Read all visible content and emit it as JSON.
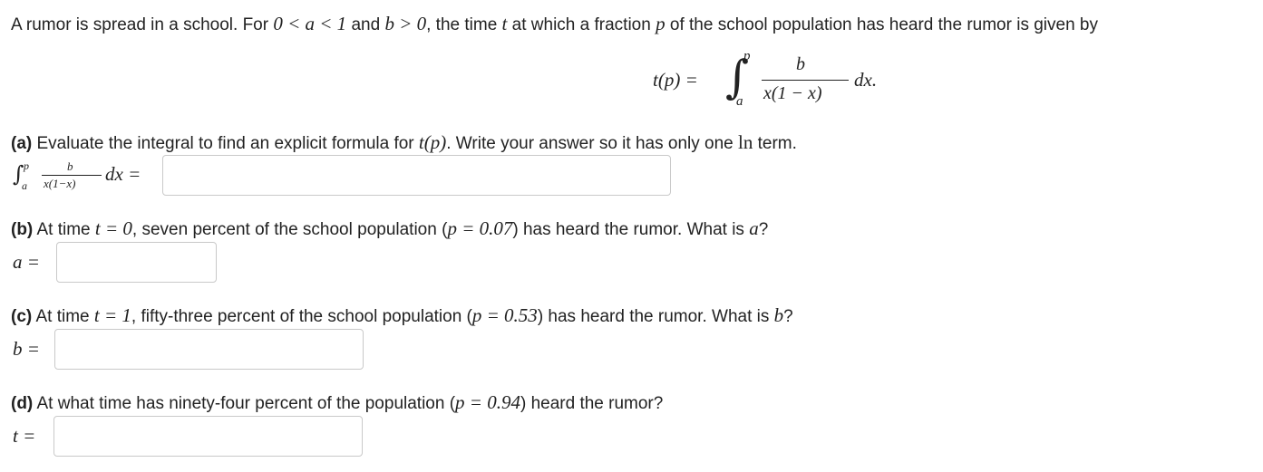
{
  "intro": {
    "text_1": "A rumor is spread in a school. For ",
    "math_1": "0 < a < 1",
    "text_2": " and ",
    "math_2": "b > 0",
    "text_3": ", the time ",
    "math_3": "t",
    "text_4": " at which a fraction ",
    "math_4": "p",
    "text_5": " of the school population has heard the rumor is given by"
  },
  "formula": {
    "lhs": "t(p) =",
    "upper": "p",
    "lower": "a",
    "numerator": "b",
    "denominator": "x(1 − x)",
    "differential": "dx."
  },
  "part_a": {
    "label": "(a)",
    "text_1": " Evaluate the integral to find an explicit formula for ",
    "math_1": "t(p)",
    "text_2": ". Write your answer so it has only one ",
    "math_2": "ln",
    "text_3": " term.",
    "answer_label": {
      "upper": "p",
      "lower": "a",
      "numerator": "b",
      "denominator": "x(1−x)",
      "differential": "dx ="
    },
    "answer_value": ""
  },
  "part_b": {
    "label": "(b)",
    "text_1": " At time ",
    "math_1": "t = 0",
    "text_2": ", seven percent of the school population (",
    "math_2": "p = 0.07",
    "text_3": ") has heard the rumor. What is ",
    "math_3": "a",
    "text_4": "?",
    "answer_label": "a =",
    "answer_value": ""
  },
  "part_c": {
    "label": "(c)",
    "text_1": " At time ",
    "math_1": "t = 1",
    "text_2": ", fifty-three percent of the school population (",
    "math_2": "p = 0.53",
    "text_3": ") has heard the rumor. What is ",
    "math_3": "b",
    "text_4": "?",
    "answer_label": "b =",
    "answer_value": ""
  },
  "part_d": {
    "label": "(d)",
    "text_1": " At what time has ninety-four percent of the population (",
    "math_1": "p = 0.94",
    "text_2": ") heard the rumor?",
    "answer_label": "t =",
    "answer_value": ""
  }
}
